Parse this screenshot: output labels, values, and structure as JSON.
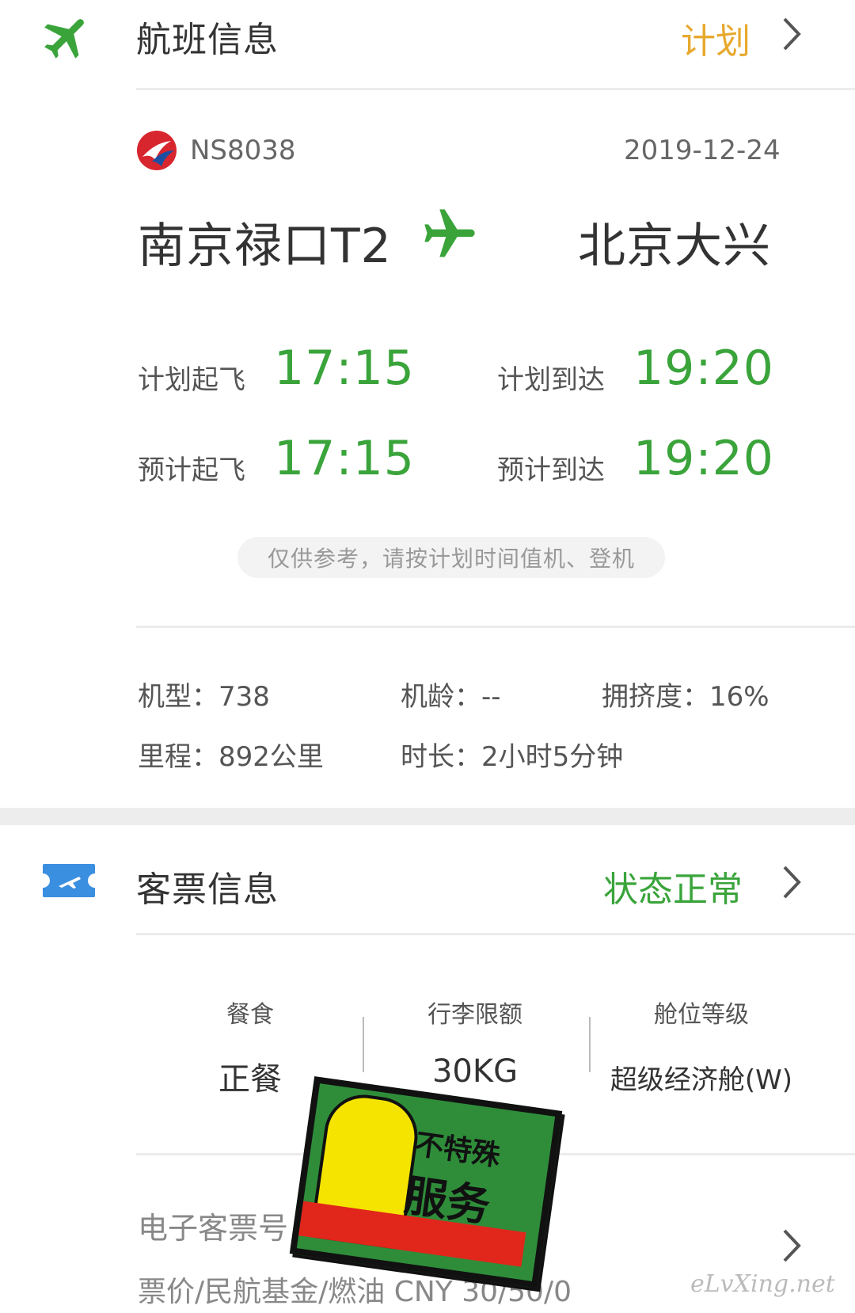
{
  "flight_section": {
    "title": "航班信息",
    "status": "计划",
    "status_color": "#e8a92f",
    "flight_no": "NS8038",
    "date": "2019-12-24",
    "from": "南京禄口T2",
    "to": "北京大兴",
    "sched_dep_label": "计划起飞",
    "sched_dep_time": "17:15",
    "sched_arr_label": "计划到达",
    "sched_arr_time": "19:20",
    "est_dep_label": "预计起飞",
    "est_dep_time": "17:15",
    "est_arr_label": "预计到达",
    "est_arr_time": "19:20",
    "notice": "仅供参考，请按计划时间值机、登机",
    "aircraft": "机型：738",
    "age": "机龄：--",
    "crowd": "拥挤度：16%",
    "distance": "里程：892公里",
    "duration": "时长：2小时5分钟"
  },
  "ticket_section": {
    "title": "客票信息",
    "status": "状态正常",
    "status_color": "#3aa43b",
    "meal_label": "餐食",
    "meal_value": "正餐",
    "baggage_label": "行李限额",
    "baggage_value": "30KG",
    "cabin_label": "舱位等级",
    "cabin_value": "超级经济舱(W)",
    "eticket_label": "电子客票号",
    "price_line": "票价/民航基金/燃油 CNY 30/50/0"
  },
  "sticker": {
    "line1": "不特殊",
    "line2": "服务"
  },
  "watermark": "eLvXing.net",
  "icons": {
    "flight": "airplane-icon",
    "ticket": "ticket-icon",
    "airline": "airline-logo-icon",
    "route": "airplane-route-icon",
    "chevron": "chevron-right-icon"
  }
}
